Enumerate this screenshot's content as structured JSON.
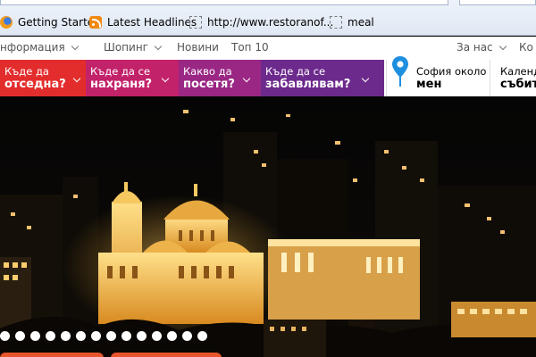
{
  "bookmarks": [
    {
      "label": "Getting Started",
      "icon": "firefox-icon"
    },
    {
      "label": "Latest Headlines",
      "icon": "rss-icon"
    },
    {
      "label": "http://www.restoranof...",
      "icon": "blank-page-icon"
    },
    {
      "label": "meal",
      "icon": "blank-page-icon"
    }
  ],
  "topnav": {
    "info": "нформация",
    "shopping": "Шопинг",
    "news": "Новини",
    "top10": "Топ 10",
    "about": "За нас",
    "contact": "Ко"
  },
  "tabs": [
    {
      "line1": "Къде да",
      "line2": "отседна?"
    },
    {
      "line1": "Къде да се",
      "line2": "нахраня?"
    },
    {
      "line1": "Какво да",
      "line2": "посетя?"
    },
    {
      "line1": "Къде да се",
      "line2": "забавлявам?"
    },
    {
      "line1": "София около",
      "line2": "мен"
    },
    {
      "line1": "Календ",
      "line2": "събит"
    }
  ],
  "colors": {
    "tab_red": "#e32d2d",
    "tab_pink": "#c2226a",
    "tab_magenta": "#9a2784",
    "tab_purple": "#6d2a8d",
    "pin_blue": "#1f8fe0",
    "accent_orange": "#e8542b"
  },
  "slider": {
    "dot_count": 14
  }
}
